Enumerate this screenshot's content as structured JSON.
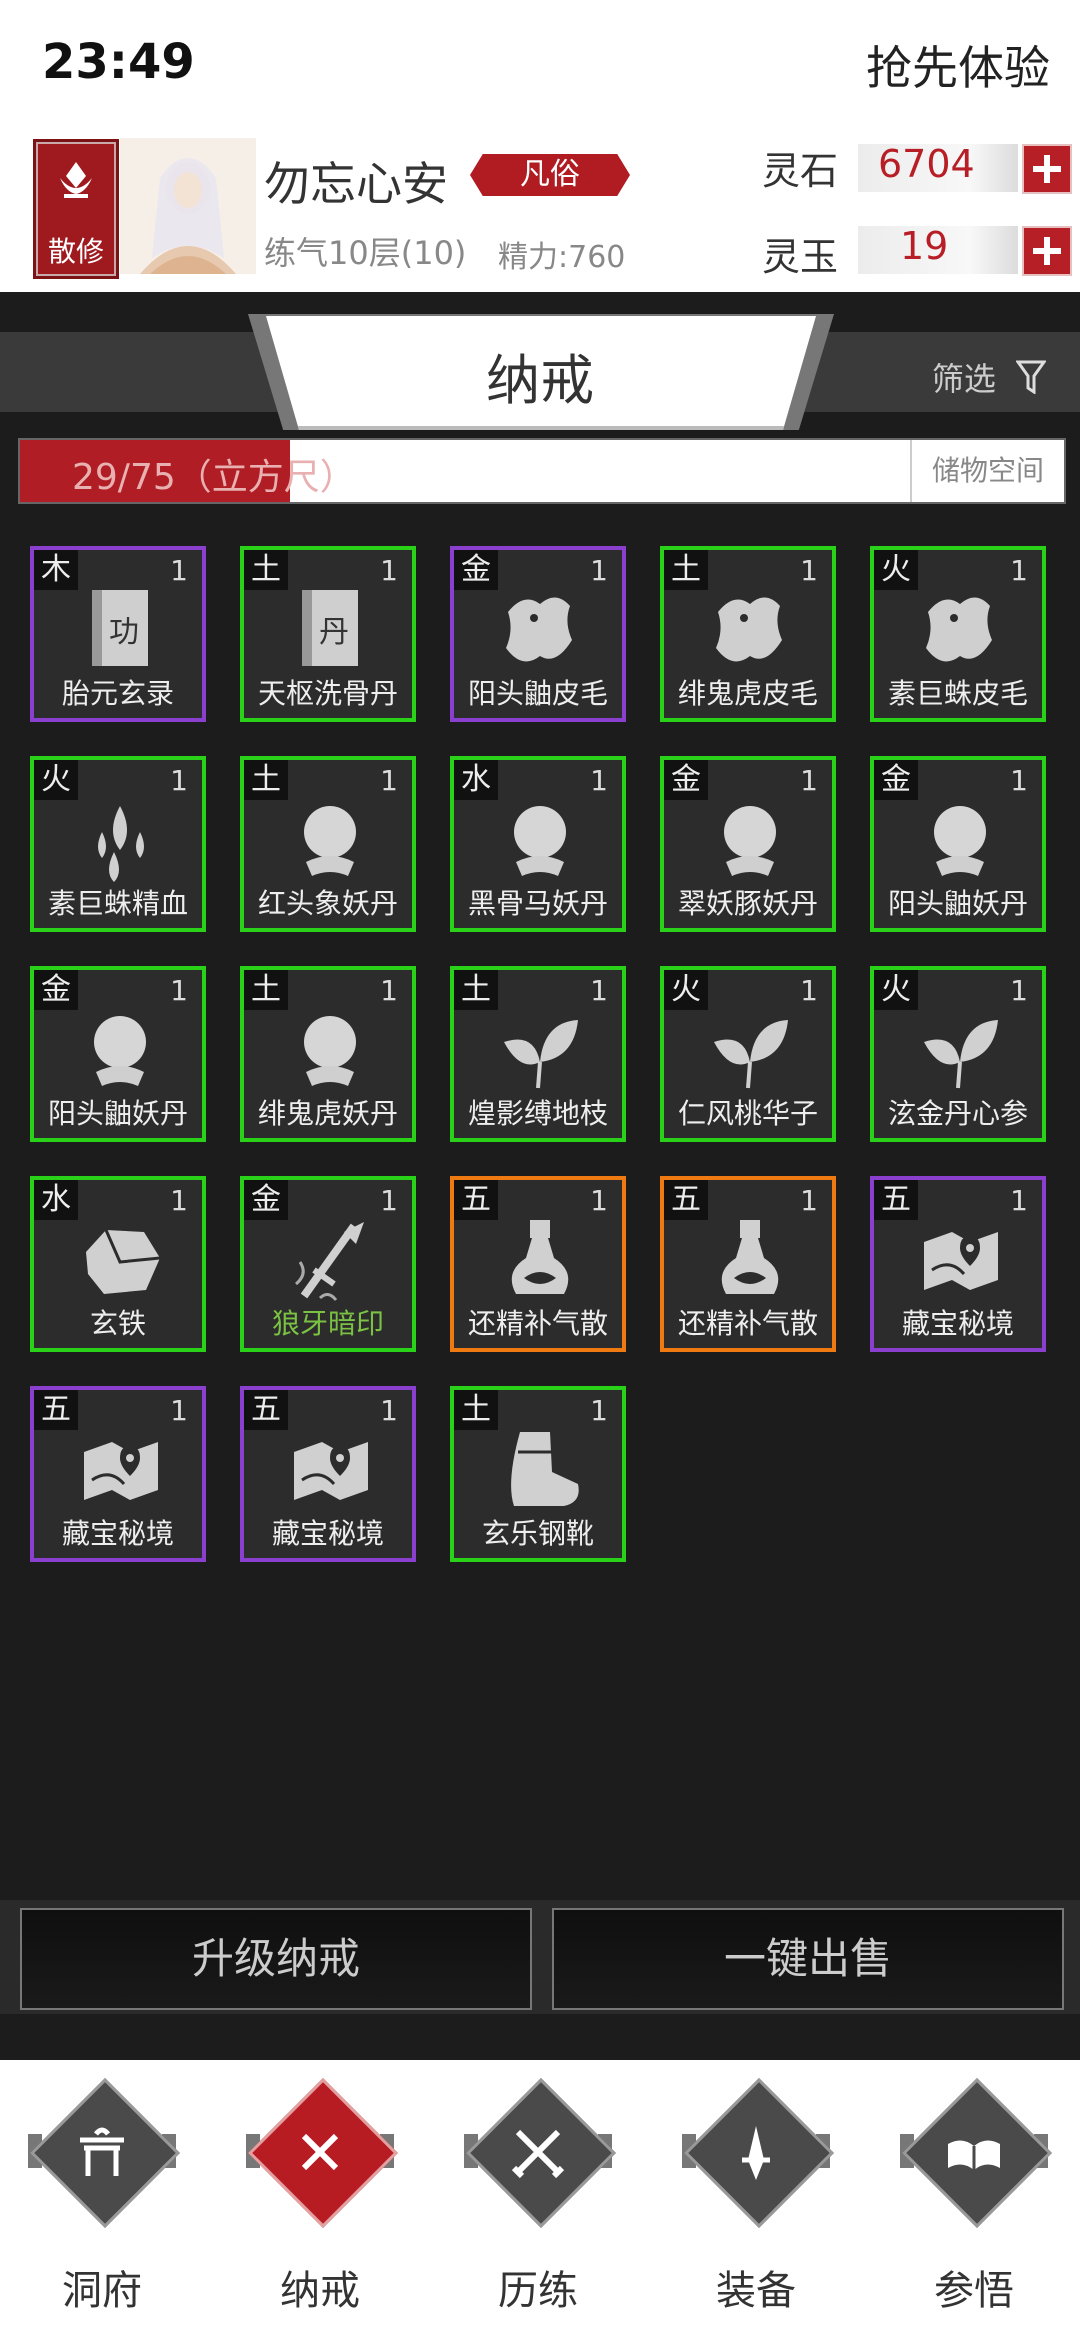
{
  "status": {
    "time": "23:49",
    "right_text": "抢先体验"
  },
  "player": {
    "sect": "散修",
    "name": "勿忘心安",
    "rank": "凡俗",
    "realm": "练气10层(10)",
    "stamina": "精力:760"
  },
  "resources": [
    {
      "label": "灵石",
      "value": "6704"
    },
    {
      "label": "灵玉",
      "value": "19"
    }
  ],
  "title": "纳戒",
  "filter_label": "筛选",
  "capacity": {
    "text": "29/75（立方尺）",
    "fill": 0.2587,
    "storage_label": "储物空间"
  },
  "items": [
    {
      "elem": "木",
      "count": "1",
      "name": "胎元玄录",
      "quality": "purple",
      "icon": "book-icon",
      "glyph": "功"
    },
    {
      "elem": "土",
      "count": "1",
      "name": "天枢洗骨丹",
      "quality": "green",
      "icon": "book-icon",
      "glyph": "丹"
    },
    {
      "elem": "金",
      "count": "1",
      "name": "阳头鼬皮毛",
      "quality": "purple",
      "icon": "pelt-icon"
    },
    {
      "elem": "土",
      "count": "1",
      "name": "绯鬼虎皮毛",
      "quality": "green",
      "icon": "pelt-icon"
    },
    {
      "elem": "火",
      "count": "1",
      "name": "素巨蛛皮毛",
      "quality": "green",
      "icon": "pelt-icon"
    },
    {
      "elem": "火",
      "count": "1",
      "name": "素巨蛛精血",
      "quality": "green",
      "icon": "blood-icon"
    },
    {
      "elem": "土",
      "count": "1",
      "name": "红头象妖丹",
      "quality": "green",
      "icon": "orb-icon"
    },
    {
      "elem": "水",
      "count": "1",
      "name": "黑骨马妖丹",
      "quality": "green",
      "icon": "orb-icon"
    },
    {
      "elem": "金",
      "count": "1",
      "name": "翠妖豚妖丹",
      "quality": "green",
      "icon": "orb-icon"
    },
    {
      "elem": "金",
      "count": "1",
      "name": "阳头鼬妖丹",
      "quality": "green",
      "icon": "orb-icon"
    },
    {
      "elem": "金",
      "count": "1",
      "name": "阳头鼬妖丹",
      "quality": "green",
      "icon": "orb-icon"
    },
    {
      "elem": "土",
      "count": "1",
      "name": "绯鬼虎妖丹",
      "quality": "green",
      "icon": "orb-icon"
    },
    {
      "elem": "土",
      "count": "1",
      "name": "煌影缚地枝",
      "quality": "green",
      "icon": "leaf-icon"
    },
    {
      "elem": "火",
      "count": "1",
      "name": "仁风桃华子",
      "quality": "green",
      "icon": "leaf-icon"
    },
    {
      "elem": "火",
      "count": "1",
      "name": "泫金丹心参",
      "quality": "green",
      "icon": "leaf-icon"
    },
    {
      "elem": "水",
      "count": "1",
      "name": "玄铁",
      "quality": "green",
      "icon": "ore-icon"
    },
    {
      "elem": "金",
      "count": "1",
      "name": "狼牙暗印",
      "quality": "green",
      "icon": "weapon-icon",
      "name_color": "green"
    },
    {
      "elem": "五",
      "count": "1",
      "name": "还精补气散",
      "quality": "orange",
      "icon": "potion-icon"
    },
    {
      "elem": "五",
      "count": "1",
      "name": "还精补气散",
      "quality": "orange",
      "icon": "potion-icon"
    },
    {
      "elem": "五",
      "count": "1",
      "name": "藏宝秘境",
      "quality": "purple",
      "icon": "map-icon"
    },
    {
      "elem": "五",
      "count": "1",
      "name": "藏宝秘境",
      "quality": "purple",
      "icon": "map-icon"
    },
    {
      "elem": "五",
      "count": "1",
      "name": "藏宝秘境",
      "quality": "purple",
      "icon": "map-icon"
    },
    {
      "elem": "土",
      "count": "1",
      "name": "玄乐钢靴",
      "quality": "green",
      "icon": "boot-icon"
    }
  ],
  "buttons": {
    "upgrade": "升级纳戒",
    "sell_all": "一键出售"
  },
  "nav": [
    {
      "label": "洞府",
      "icon": "gate-icon",
      "active": false
    },
    {
      "label": "纳戒",
      "icon": "close-x-icon",
      "active": true
    },
    {
      "label": "历练",
      "icon": "swords-icon",
      "active": false
    },
    {
      "label": "装备",
      "icon": "dagger-icon",
      "active": false
    },
    {
      "label": "参悟",
      "icon": "open-book-icon",
      "active": false
    }
  ],
  "colors": {
    "accent_red": "#b01d24",
    "quality_green": "#29d219",
    "quality_purple": "#8a3fcf",
    "quality_orange": "#f07a12"
  }
}
